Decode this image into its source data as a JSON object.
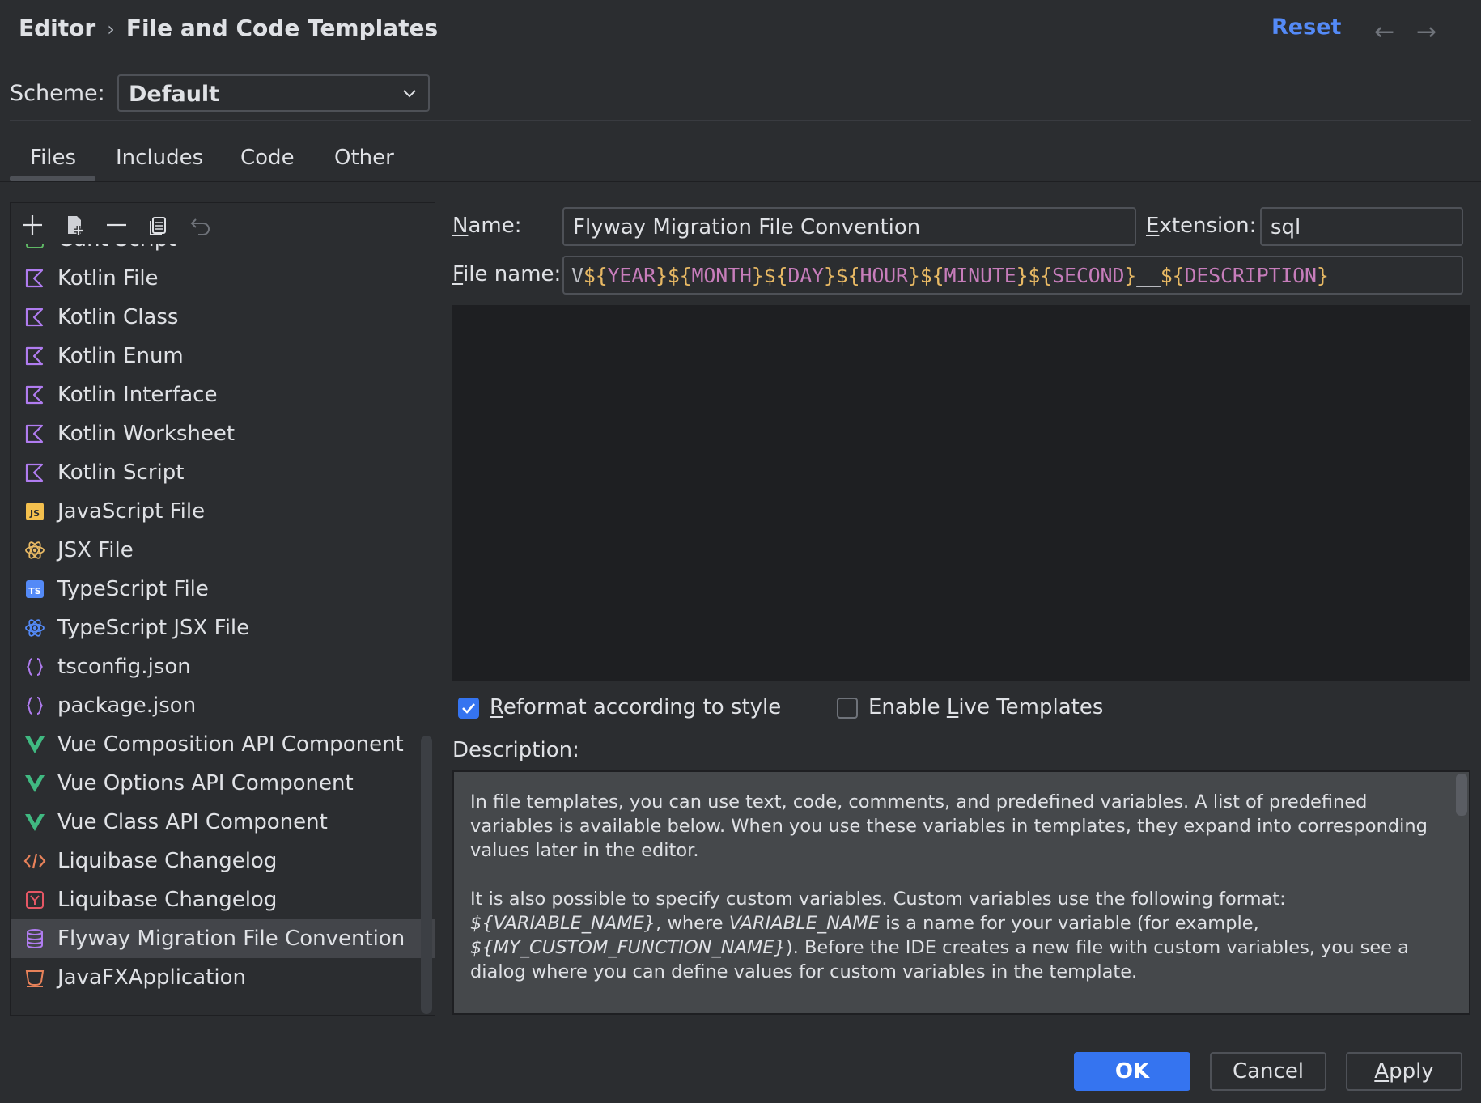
{
  "header": {
    "breadcrumb": [
      "Editor",
      "File and Code Templates"
    ],
    "separator": "›",
    "reset_label": "Reset",
    "back_arrow": "←",
    "forward_arrow": "→"
  },
  "scheme": {
    "label": "Scheme:",
    "value": "Default"
  },
  "tabs": [
    {
      "label": "Files",
      "selected": true
    },
    {
      "label": "Includes"
    },
    {
      "label": "Code"
    },
    {
      "label": "Other"
    }
  ],
  "toolbar": {
    "icons": [
      "plus-icon",
      "new-child-icon",
      "minus-icon",
      "copy-icon",
      "undo-icon"
    ]
  },
  "templates": [
    {
      "label": "Gant Script",
      "icon": "gant-icon",
      "color": "#5fb865"
    },
    {
      "label": "Kotlin File",
      "icon": "kotlin-icon",
      "color": "#b07cf0"
    },
    {
      "label": "Kotlin Class",
      "icon": "kotlin-icon",
      "color": "#b07cf0"
    },
    {
      "label": "Kotlin Enum",
      "icon": "kotlin-icon",
      "color": "#b07cf0"
    },
    {
      "label": "Kotlin Interface",
      "icon": "kotlin-icon",
      "color": "#b07cf0"
    },
    {
      "label": "Kotlin Worksheet",
      "icon": "kotlin-icon",
      "color": "#b07cf0"
    },
    {
      "label": "Kotlin Script",
      "icon": "kotlin-icon",
      "color": "#b07cf0"
    },
    {
      "label": "JavaScript File",
      "icon": "js-icon",
      "color": "#f4c04e"
    },
    {
      "label": "JSX File",
      "icon": "react-icon",
      "color": "#e8b964"
    },
    {
      "label": "TypeScript File",
      "icon": "ts-icon",
      "color": "#548af7"
    },
    {
      "label": "TypeScript JSX File",
      "icon": "react-icon",
      "color": "#548af7"
    },
    {
      "label": "tsconfig.json",
      "icon": "json-icon",
      "color": "#b07cf0"
    },
    {
      "label": "package.json",
      "icon": "json-icon",
      "color": "#b07cf0"
    },
    {
      "label": "Vue Composition API Component",
      "icon": "vue-icon",
      "color": "#40b981"
    },
    {
      "label": "Vue Options API Component",
      "icon": "vue-icon",
      "color": "#40b981"
    },
    {
      "label": "Vue Class API Component",
      "icon": "vue-icon",
      "color": "#40b981"
    },
    {
      "label": "Liquibase Changelog",
      "icon": "xml-icon",
      "color": "#e8825a"
    },
    {
      "label": "Liquibase Changelog",
      "icon": "yaml-icon",
      "color": "#e55765"
    },
    {
      "label": "Flyway Migration File Convention",
      "icon": "database-icon",
      "color": "#b07cf0",
      "selected": true
    },
    {
      "label": "JavaFXApplication",
      "icon": "javafx-icon",
      "color": "#e8825a"
    }
  ],
  "form": {
    "name_label": "Name:",
    "name_value": "Flyway Migration File Convention",
    "extension_label": "Extension:",
    "extension_value": "sql",
    "filename_label": "File name:",
    "filename_value": "V${YEAR}${MONTH}${DAY}${HOUR}${MINUTE}${SECOND}__${DESCRIPTION}",
    "filename_parts": [
      {
        "t": "V",
        "k": "t"
      },
      {
        "t": "${",
        "k": "d"
      },
      {
        "t": "YEAR",
        "k": "vv"
      },
      {
        "t": "}",
        "k": "d"
      },
      {
        "t": "${",
        "k": "d"
      },
      {
        "t": "MONTH",
        "k": "vv"
      },
      {
        "t": "}",
        "k": "d"
      },
      {
        "t": "${",
        "k": "d"
      },
      {
        "t": "DAY",
        "k": "vv"
      },
      {
        "t": "}",
        "k": "d"
      },
      {
        "t": "${",
        "k": "d"
      },
      {
        "t": "HOUR",
        "k": "vv"
      },
      {
        "t": "}",
        "k": "d"
      },
      {
        "t": "${",
        "k": "d"
      },
      {
        "t": "MINUTE",
        "k": "vv"
      },
      {
        "t": "}",
        "k": "d"
      },
      {
        "t": "${",
        "k": "d"
      },
      {
        "t": "SECOND",
        "k": "vv"
      },
      {
        "t": "}",
        "k": "d"
      },
      {
        "t": "__",
        "k": "t"
      },
      {
        "t": "${",
        "k": "d"
      },
      {
        "t": "DESCRIPTION",
        "k": "vv"
      },
      {
        "t": "}",
        "k": "d"
      }
    ],
    "reformat_label": "Reformat according to style",
    "reformat_checked": true,
    "live_templates_label": "Enable Live Templates",
    "live_templates_checked": false,
    "description_label": "Description:"
  },
  "description": {
    "p1": "In file templates, you can use text, code, comments, and predefined variables. A list of predefined variables is available below. When you use these variables in templates, they expand into corresponding values later in the editor.",
    "p2_var1": "${VARIABLE_NAME}",
    "p2_a": "It is also possible to specify custom variables. Custom variables use the following format: ",
    "p2_b": ", where ",
    "p2_var2": "VARIABLE_NAME",
    "p2_c": " is a name for your variable (for example, ",
    "p2_var3": "${MY_CUSTOM_FUNCTION_NAME}",
    "p2_d": "). Before the IDE creates a new file with custom variables, you see a dialog where you can define values for custom variables in the template."
  },
  "footer": {
    "ok_label": "OK",
    "cancel_label": "Cancel",
    "apply_label": "Apply"
  },
  "colors": {
    "background": "#2b2d30",
    "accent": "#3574f0",
    "link": "#548af7",
    "selection": "#43454a",
    "editor_bg": "#1e1f22"
  }
}
